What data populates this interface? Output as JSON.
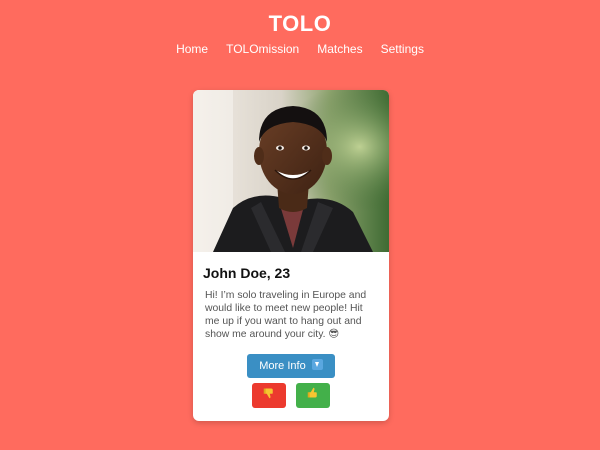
{
  "app": {
    "title": "TOLO"
  },
  "nav": {
    "items": [
      {
        "label": "Home"
      },
      {
        "label": "TOLOmission"
      },
      {
        "label": "Matches"
      },
      {
        "label": "Settings"
      }
    ]
  },
  "profile": {
    "name": "John Doe, 23",
    "bio": "Hi! I’m solo traveling in Europe and would like to meet new people! Hit me up if you want to hang out and show me around your city. 😎",
    "more_info_label": "More Info",
    "more_info_icon": "down-arrow-icon",
    "dislike_icon": "thumbs-down-icon",
    "like_icon": "thumbs-up-icon"
  },
  "colors": {
    "background": "#ff6b5e",
    "card": "#ffffff",
    "more_info": "#3a8fc4",
    "dislike": "#ec3a2e",
    "like": "#43b04a"
  }
}
